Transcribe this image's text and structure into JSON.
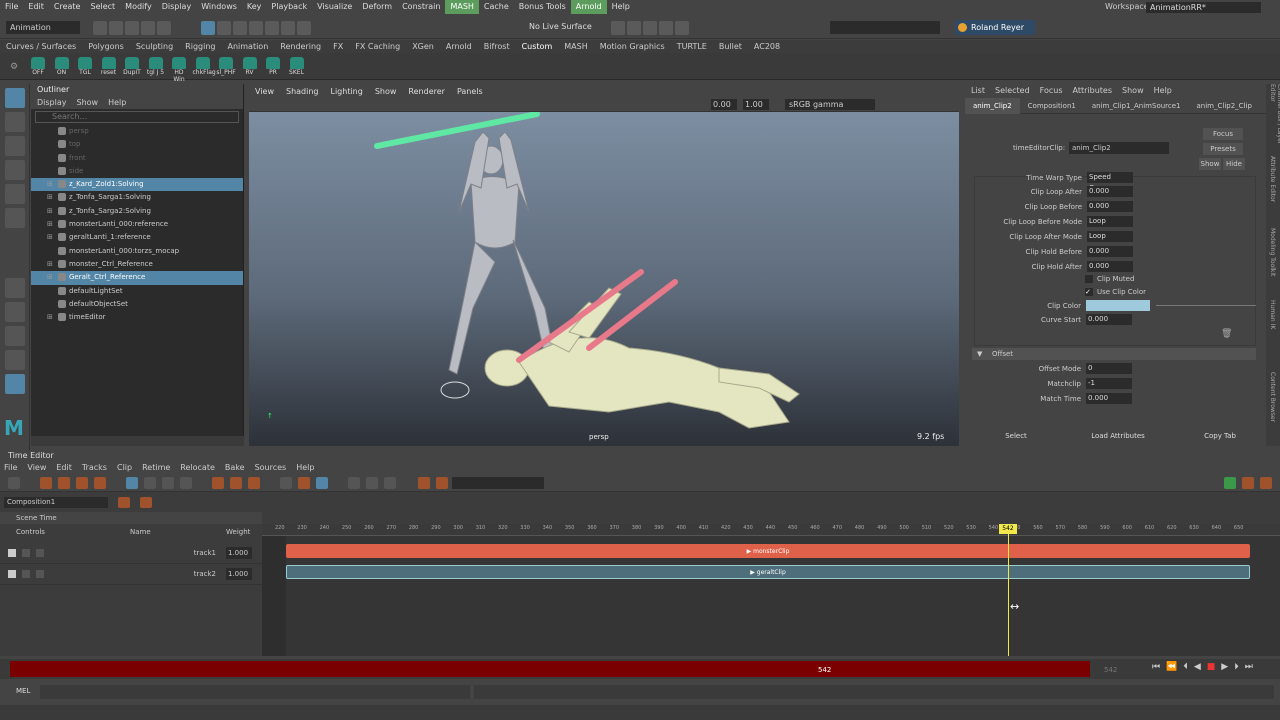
{
  "menubar": {
    "items": [
      "File",
      "Edit",
      "Create",
      "Select",
      "Modify",
      "Display",
      "Windows",
      "Key",
      "Playback",
      "Visualize",
      "Deform",
      "Constrain",
      "MASH",
      "Cache",
      "Bonus Tools",
      "Arnold",
      "Help"
    ],
    "workspace_label": "Workspace :",
    "workspace_value": "AnimationRR*"
  },
  "status": {
    "mode": "Animation",
    "live_surface": "No Live Surface",
    "user": "Roland Reyer"
  },
  "shelf": {
    "tabs": [
      "Curves / Surfaces",
      "Polygons",
      "Sculpting",
      "Rigging",
      "Animation",
      "Rendering",
      "FX",
      "FX Caching",
      "XGen",
      "Arnold",
      "Bifrost",
      "Custom",
      "MASH",
      "Motion Graphics",
      "TURTLE",
      "Bullet",
      "AC208"
    ],
    "active_tab": "Custom",
    "icons": [
      "OFF",
      "ON",
      "TGL",
      "reset",
      "DupIT",
      "tgl J 5",
      "HD Win",
      "chkFlag",
      "sl_PHF",
      "RV",
      "PR",
      "SKEL"
    ]
  },
  "outliner": {
    "title": "Outliner",
    "menu": [
      "Display",
      "Show",
      "Help"
    ],
    "search_placeholder": "Search...",
    "items": [
      {
        "label": "persp",
        "dim": true,
        "sel": false,
        "expand": ""
      },
      {
        "label": "top",
        "dim": true,
        "sel": false,
        "expand": ""
      },
      {
        "label": "front",
        "dim": true,
        "sel": false,
        "expand": ""
      },
      {
        "label": "side",
        "dim": true,
        "sel": false,
        "expand": ""
      },
      {
        "label": "z_Kard_Zold1:Solving",
        "dim": false,
        "sel": true,
        "expand": "⊞"
      },
      {
        "label": "z_Tonfa_Sarga1:Solving",
        "dim": false,
        "sel": false,
        "expand": "⊞"
      },
      {
        "label": "z_Tonfa_Sarga2:Solving",
        "dim": false,
        "sel": false,
        "expand": "⊞"
      },
      {
        "label": "monsterLanti_000:reference",
        "dim": false,
        "sel": false,
        "expand": "⊞"
      },
      {
        "label": "geraltLanti_1:reference",
        "dim": false,
        "sel": false,
        "expand": "⊞"
      },
      {
        "label": "monsterLanti_000:torzs_mocap",
        "dim": false,
        "sel": false,
        "expand": ""
      },
      {
        "label": "monster_Ctrl_Reference",
        "dim": false,
        "sel": false,
        "expand": "⊞"
      },
      {
        "label": "Geralt_Ctrl_Reference",
        "dim": false,
        "sel": true,
        "expand": "⊞"
      },
      {
        "label": "defaultLightSet",
        "dim": false,
        "sel": false,
        "expand": ""
      },
      {
        "label": "defaultObjectSet",
        "dim": false,
        "sel": false,
        "expand": ""
      },
      {
        "label": "timeEditor",
        "dim": false,
        "sel": false,
        "expand": "⊞"
      }
    ]
  },
  "viewport": {
    "menu": [
      "View",
      "Shading",
      "Lighting",
      "Show",
      "Renderer",
      "Panels"
    ],
    "exposure": "0.00",
    "gamma": "1.00",
    "color_space": "sRGB gamma",
    "camera": "persp",
    "fps": "9.2 fps"
  },
  "attribute_editor": {
    "menu": [
      "List",
      "Selected",
      "Focus",
      "Attributes",
      "Show",
      "Help"
    ],
    "tabs": [
      "anim_Clip2",
      "Composition1",
      "anim_Clip1_AnimSource1",
      "anim_Clip2_Clip"
    ],
    "node_label": "timeEditorClip:",
    "node_value": "anim_Clip2",
    "focus": "Focus",
    "presets": "Presets",
    "show": "Show",
    "hide": "Hide",
    "attrs": [
      {
        "label": "Time Warp Type",
        "value": "Speed Curve"
      },
      {
        "label": "Clip Loop After",
        "value": "0.000"
      },
      {
        "label": "Clip Loop Before",
        "value": "0.000"
      },
      {
        "label": "Clip Loop Before Mode",
        "value": "Loop"
      },
      {
        "label": "Clip Loop After Mode",
        "value": "Loop"
      },
      {
        "label": "Clip Hold Before",
        "value": "0.000"
      },
      {
        "label": "Clip Hold After",
        "value": "0.000"
      }
    ],
    "clip_muted": "Clip Muted",
    "use_clip_color": "Use Clip Color",
    "clip_color_label": "Clip Color",
    "curve_start_label": "Curve Start",
    "curve_start_value": "0.000",
    "offset_section": "Offset",
    "offset_mode_label": "Offset Mode",
    "offset_mode_value": "0",
    "matchclip_label": "Matchclip",
    "matchclip_value": "-1",
    "match_time_label": "Match Time",
    "match_time_value": "0.000",
    "buttons": [
      "Select",
      "Load Attributes",
      "Copy Tab"
    ],
    "side_tabs": [
      "Channel Box / Layer Editor",
      "Attribute Editor",
      "Modeling Toolkit",
      "Human IK",
      "Content Browser"
    ]
  },
  "time_editor": {
    "title": "Time Editor",
    "menu": [
      "File",
      "View",
      "Edit",
      "Tracks",
      "Clip",
      "Retime",
      "Relocate",
      "Bake",
      "Sources",
      "Help"
    ],
    "composition": "Composition1",
    "scene_time": "Scene Time",
    "col_controls": "Controls",
    "col_name": "Name",
    "col_weight": "Weight",
    "ruler_ticks": [
      "220",
      "230",
      "240",
      "250",
      "260",
      "270",
      "280",
      "290",
      "300",
      "310",
      "320",
      "330",
      "340",
      "350",
      "360",
      "370",
      "380",
      "390",
      "400",
      "410",
      "420",
      "430",
      "440",
      "450",
      "460",
      "470",
      "480",
      "490",
      "500",
      "510",
      "520",
      "530",
      "540",
      "550",
      "560",
      "570",
      "580",
      "590",
      "600",
      "610",
      "620",
      "630",
      "640",
      "650"
    ],
    "current_frame": "542",
    "tracks": [
      {
        "name": "track1",
        "weight": "1.000",
        "clip": "monsterClip",
        "color": "#e0614a"
      },
      {
        "name": "track2",
        "weight": "1.000",
        "clip": "geraltClip",
        "color": "#4d6e7a"
      }
    ]
  },
  "playback": {
    "current": "542",
    "end": "542"
  },
  "command_line": {
    "lang": "MEL"
  }
}
